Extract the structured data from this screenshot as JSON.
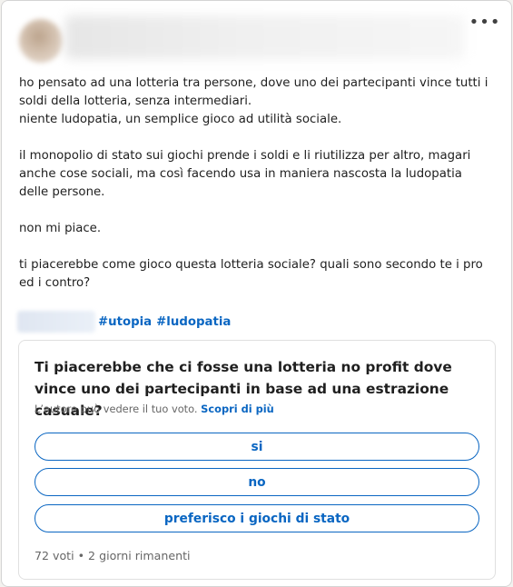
{
  "post": {
    "menu_glyph": "•••",
    "paragraphs": [
      [
        "ho pensato ad una lotteria tra persone, dove uno dei partecipanti vince tutti i soldi della lotteria, senza intermediari.",
        "niente ludopatia, un semplice gioco ad utilità sociale."
      ],
      [
        "il monopolio di stato sui giochi prende i soldi e li riutilizza per altro, magari anche cose sociali, ma così facendo usa in maniera nascosta la ludopatia delle persone."
      ],
      [
        "non mi piace."
      ],
      [
        "ti piacerebbe come gioco questa lotteria sociale? quali sono secondo te i pro ed i contro?"
      ]
    ],
    "hashtags": [
      "#utopia",
      "#ludopatia"
    ]
  },
  "poll": {
    "question": "Ti piacerebbe che ci fosse una lotteria no profit dove vince uno dei partecipanti in base ad una estrazione casuale?",
    "note": "L’autore può vedere il tuo voto.",
    "note_link": "Scopri di più",
    "options": [
      "si",
      "no",
      "preferisco i giochi di stato"
    ],
    "meta": "72 voti • 2 giorni rimanenti"
  },
  "colors": {
    "accent": "#0a66c2",
    "text": "#1f1f1f",
    "muted": "#666666",
    "border": "#e0e0e0"
  },
  "icons": {
    "menu": "more-horizontal-icon"
  }
}
